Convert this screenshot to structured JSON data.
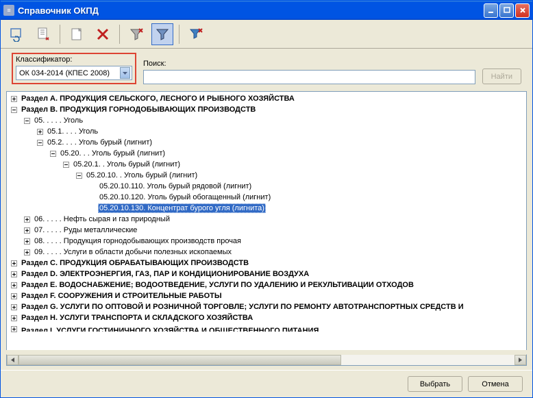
{
  "window": {
    "title": "Справочник ОКПД"
  },
  "toolbar": {
    "icons": [
      "refresh",
      "export",
      "new",
      "delete",
      "filter-off",
      "filter",
      "filter-clear"
    ]
  },
  "filter": {
    "classifier_label": "Классификатор:",
    "classifier_value": "ОК 034-2014 (КПЕС 2008)",
    "search_label": "Поиск:",
    "search_value": "",
    "find_button": "Найти"
  },
  "tree": [
    {
      "indent": 0,
      "exp": "plus",
      "bold": true,
      "text": "Раздел A. ПРОДУКЦИЯ СЕЛЬСКОГО, ЛЕСНОГО И РЫБНОГО ХОЗЯЙСТВА"
    },
    {
      "indent": 0,
      "exp": "minus",
      "bold": true,
      "text": "Раздел B. ПРОДУКЦИЯ ГОРНОДОБЫВАЮЩИХ ПРОИЗВОДСТВ"
    },
    {
      "indent": 1,
      "exp": "minus",
      "bold": false,
      "text": "05. . . . . Уголь"
    },
    {
      "indent": 2,
      "exp": "plus",
      "bold": false,
      "text": "05.1. . . . Уголь"
    },
    {
      "indent": 2,
      "exp": "minus",
      "bold": false,
      "text": "05.2. . . . Уголь бурый (лигнит)"
    },
    {
      "indent": 3,
      "exp": "minus",
      "bold": false,
      "text": "05.20. . . Уголь бурый (лигнит)"
    },
    {
      "indent": 4,
      "exp": "minus",
      "bold": false,
      "text": "05.20.1. . Уголь бурый (лигнит)"
    },
    {
      "indent": 5,
      "exp": "minus",
      "bold": false,
      "text": "05.20.10. . Уголь бурый (лигнит)"
    },
    {
      "indent": 6,
      "exp": "none",
      "bold": false,
      "text": "05.20.10.110. Уголь бурый рядовой (лигнит)"
    },
    {
      "indent": 6,
      "exp": "none",
      "bold": false,
      "text": "05.20.10.120. Уголь бурый обогащенный (лигнит)"
    },
    {
      "indent": 6,
      "exp": "none",
      "bold": false,
      "text": "05.20.10.130. Концентрат бурого угля (лигнита)",
      "selected": true
    },
    {
      "indent": 1,
      "exp": "plus",
      "bold": false,
      "text": "06. . . . . Нефть сырая и газ природный"
    },
    {
      "indent": 1,
      "exp": "plus",
      "bold": false,
      "text": "07. . . . . Руды металлические"
    },
    {
      "indent": 1,
      "exp": "plus",
      "bold": false,
      "text": "08. . . . . Продукция горнодобывающих производств прочая"
    },
    {
      "indent": 1,
      "exp": "plus",
      "bold": false,
      "text": "09. . . . . Услуги в области добычи полезных ископаемых"
    },
    {
      "indent": 0,
      "exp": "plus",
      "bold": true,
      "text": "Раздел C. ПРОДУКЦИЯ ОБРАБАТЫВАЮЩИХ ПРОИЗВОДСТВ"
    },
    {
      "indent": 0,
      "exp": "plus",
      "bold": true,
      "text": "Раздел D. ЭЛЕКТРОЭНЕРГИЯ, ГАЗ, ПАР И КОНДИЦИОНИРОВАНИЕ ВОЗДУХА"
    },
    {
      "indent": 0,
      "exp": "plus",
      "bold": true,
      "text": "Раздел E. ВОДОСНАБЖЕНИЕ; ВОДООТВЕДЕНИЕ, УСЛУГИ ПО УДАЛЕНИЮ И РЕКУЛЬТИВАЦИИ ОТХОДОВ"
    },
    {
      "indent": 0,
      "exp": "plus",
      "bold": true,
      "text": "Раздел F. СООРУЖЕНИЯ И СТРОИТЕЛЬНЫЕ РАБОТЫ"
    },
    {
      "indent": 0,
      "exp": "plus",
      "bold": true,
      "text": "Раздел G. УСЛУГИ ПО ОПТОВОЙ И РОЗНИЧНОЙ ТОРГОВЛЕ; УСЛУГИ ПО РЕМОНТУ АВТОТРАНСПОРТНЫХ СРЕДСТВ И"
    },
    {
      "indent": 0,
      "exp": "plus",
      "bold": true,
      "text": "Раздел H. УСЛУГИ ТРАНСПОРТА И СКЛАДСКОГО ХОЗЯЙСТВА"
    },
    {
      "indent": 0,
      "exp": "plus",
      "bold": true,
      "text": "Раздел I. УСЛУГИ ГОСТИНИЧНОГО ХОЗЯЙСТВА И ОБЩЕСТВЕННОГО ПИТАНИЯ",
      "cut": true
    }
  ],
  "buttons": {
    "select": "Выбрать",
    "cancel": "Отмена"
  }
}
